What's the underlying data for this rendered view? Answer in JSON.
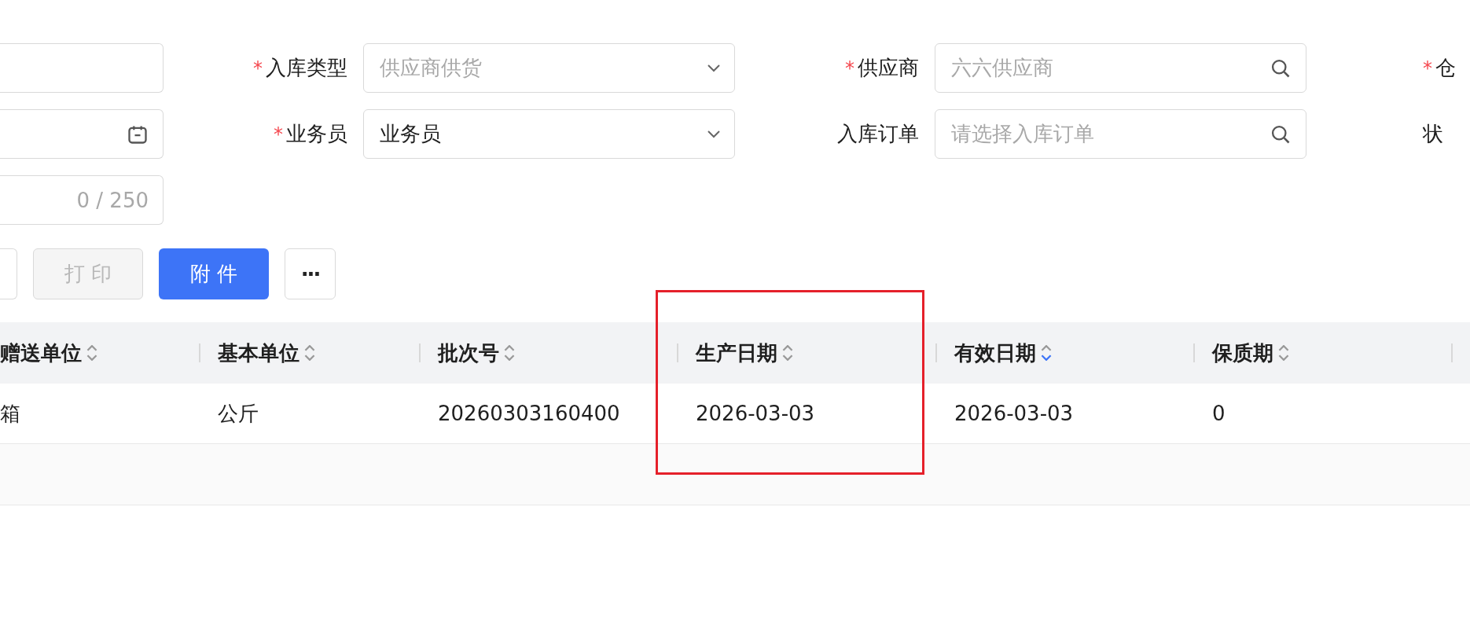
{
  "form": {
    "rows": [
      {
        "left": {
          "kind": "input"
        },
        "fields": [
          {
            "mark": "*",
            "label": "入库类型",
            "kind": "select",
            "placeholder": "供应商供货"
          },
          {
            "mark": "*",
            "label": "供应商",
            "kind": "search",
            "placeholder": "六六供应商"
          },
          {
            "mark": "*",
            "label": "仓",
            "kind": "cut"
          }
        ]
      },
      {
        "left": {
          "kind": "date"
        },
        "fields": [
          {
            "mark": "*",
            "label": "业务员",
            "kind": "select",
            "value": "业务员"
          },
          {
            "label": "入库订单",
            "kind": "search",
            "placeholder": "请选择入库订单"
          },
          {
            "label": "状",
            "kind": "cut"
          }
        ]
      },
      {
        "left": {
          "kind": "textarea",
          "counter": "0 / 250"
        },
        "fields": []
      }
    ]
  },
  "toolbar": [
    {
      "kind": "cut"
    },
    {
      "kind": "default",
      "label": "打 印",
      "disabled": true
    },
    {
      "kind": "primary",
      "label": "附 件"
    },
    {
      "kind": "more",
      "label": "···"
    }
  ],
  "table": {
    "columns": [
      {
        "label": "赠送单位",
        "sorted_descending": false,
        "highlighted": false
      },
      {
        "label": "基本单位",
        "sorted_descending": false,
        "highlighted": false
      },
      {
        "label": "批次号",
        "sorted_descending": false,
        "highlighted": false
      },
      {
        "label": "生产日期",
        "sorted_descending": false,
        "highlighted": true
      },
      {
        "label": "有效日期",
        "sorted_descending": true,
        "highlighted": false
      },
      {
        "label": "保质期",
        "sorted_descending": false,
        "highlighted": false
      },
      {
        "highlighted": false
      }
    ],
    "rows": [
      [
        "箱",
        "公斤",
        "20260303160400",
        "2026-03-03",
        "2026-03-03",
        "0"
      ]
    ]
  }
}
